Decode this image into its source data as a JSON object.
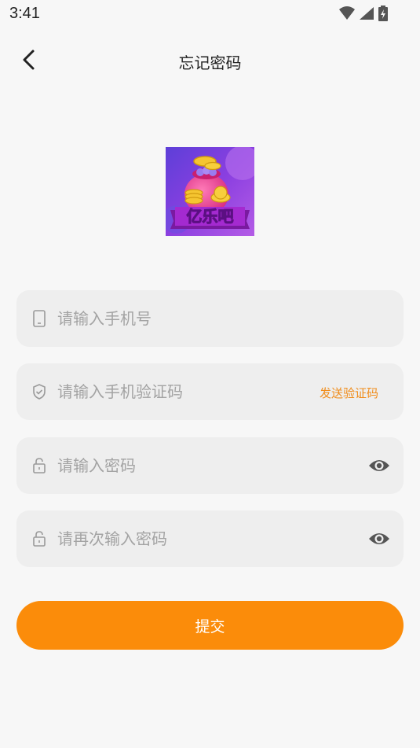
{
  "status_bar": {
    "time": "3:41"
  },
  "header": {
    "title": "忘记密码"
  },
  "logo": {
    "text": "亿乐吧"
  },
  "form": {
    "phone_placeholder": "请输入手机号",
    "code_placeholder": "请输入手机验证码",
    "send_code_label": "发送验证码",
    "password_placeholder": "请输入密码",
    "confirm_password_placeholder": "请再次输入密码",
    "submit_label": "提交"
  },
  "colors": {
    "accent": "#fb8c0a",
    "send_code": "#f08c1a",
    "field_bg": "#eeeeee",
    "page_bg": "#f7f7f7"
  }
}
